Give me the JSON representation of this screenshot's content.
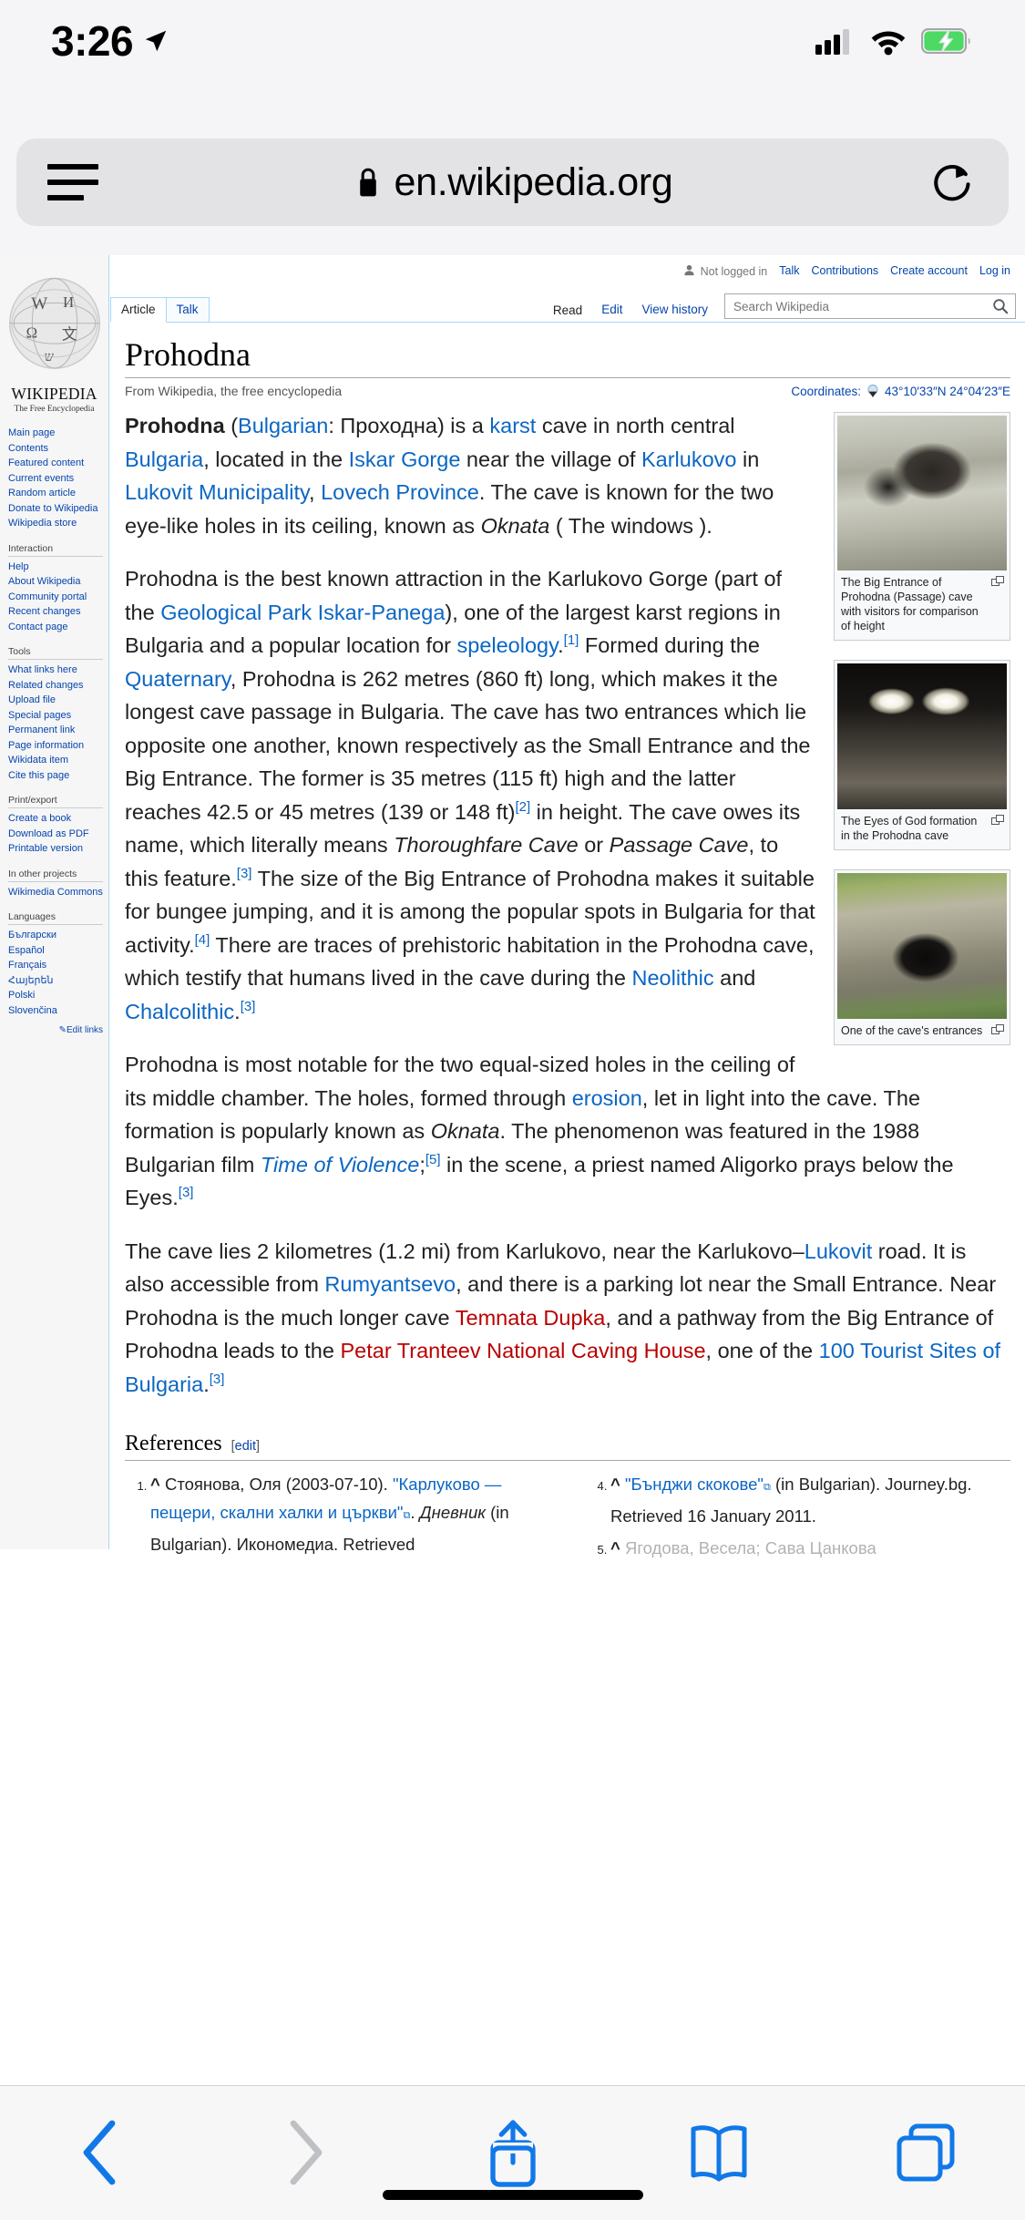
{
  "status_bar": {
    "time": "3:26",
    "location_icon": "location-arrow-icon",
    "cellular_icon": "cellular-signal-icon",
    "wifi_icon": "wifi-icon",
    "battery_icon": "battery-charging-icon"
  },
  "browser": {
    "menu_icon": "hamburger-menu-icon",
    "lock_icon": "lock-icon",
    "url": "en.wikipedia.org",
    "reload_icon": "reload-icon",
    "toolbar": {
      "back_icon": "chevron-left-icon",
      "forward_icon": "chevron-right-icon",
      "share_icon": "share-icon",
      "bookmarks_icon": "book-icon",
      "tabs_icon": "tabs-icon"
    }
  },
  "wiki": {
    "wordmark_main": "WIKIPEDIA",
    "wordmark_sub": "The Free Encyclopedia",
    "personal": {
      "not_logged_in": "Not logged in",
      "links": [
        "Talk",
        "Contributions",
        "Create account",
        "Log in"
      ]
    },
    "namespace_tabs": [
      {
        "label": "Article",
        "selected": true
      },
      {
        "label": "Talk",
        "selected": false
      }
    ],
    "view_tabs": [
      {
        "label": "Read",
        "selected": true
      },
      {
        "label": "Edit",
        "selected": false
      },
      {
        "label": "View history",
        "selected": false
      }
    ],
    "search_placeholder": "Search Wikipedia",
    "search_value": "",
    "sidebar": [
      {
        "heading": "",
        "items": [
          "Main page",
          "Contents",
          "Featured content",
          "Current events",
          "Random article",
          "Donate to Wikipedia",
          "Wikipedia store"
        ]
      },
      {
        "heading": "Interaction",
        "items": [
          "Help",
          "About Wikipedia",
          "Community portal",
          "Recent changes",
          "Contact page"
        ]
      },
      {
        "heading": "Tools",
        "items": [
          "What links here",
          "Related changes",
          "Upload file",
          "Special pages",
          "Permanent link",
          "Page information",
          "Wikidata item",
          "Cite this page"
        ]
      },
      {
        "heading": "Print/export",
        "items": [
          "Create a book",
          "Download as PDF",
          "Printable version"
        ]
      },
      {
        "heading": "In other projects",
        "items": [
          "Wikimedia Commons"
        ]
      },
      {
        "heading": "Languages",
        "items": [
          "Български",
          "Español",
          "Français",
          "Հայերեն",
          "Polski",
          "Slovenčina"
        ]
      }
    ],
    "edit_links": "Edit links"
  },
  "article": {
    "title": "Prohodna",
    "site_sub": "From Wikipedia, the free encyclopedia",
    "coordinates_label": "Coordinates:",
    "coordinates_value": "43°10′33″N 24°04′23″E",
    "thumbs": [
      {
        "caption": "The Big Entrance of Prohodna (Passage) cave with visitors for comparison of height",
        "magnify_icon": "magnify-icon"
      },
      {
        "caption": "The Eyes of God formation in the Prohodna cave",
        "magnify_icon": "magnify-icon"
      },
      {
        "caption": "One of the cave's entrances",
        "magnify_icon": "magnify-icon"
      }
    ],
    "paragraphs": [
      [
        {
          "t": "Prohodna",
          "s": "b"
        },
        {
          "t": " ("
        },
        {
          "t": "Bulgarian",
          "s": "a"
        },
        {
          "t": ": Проходна) is a "
        },
        {
          "t": "karst",
          "s": "a"
        },
        {
          "t": " cave in north central "
        },
        {
          "t": "Bulgaria",
          "s": "a"
        },
        {
          "t": ", located in the "
        },
        {
          "t": "Iskar Gorge",
          "s": "a"
        },
        {
          "t": " near the village of "
        },
        {
          "t": "Karlukovo",
          "s": "a"
        },
        {
          "t": " in "
        },
        {
          "t": "Lukovit Municipality",
          "s": "a"
        },
        {
          "t": ", "
        },
        {
          "t": "Lovech Province",
          "s": "a"
        },
        {
          "t": ". The cave is known for the two eye-like holes in its ceiling, known as "
        },
        {
          "t": "Oknata",
          "s": "i"
        },
        {
          "t": " ( The windows )."
        }
      ],
      [
        {
          "t": "Prohodna is the best known attraction in the Karlukovo Gorge (part of the "
        },
        {
          "t": "Geological Park Iskar-Panega",
          "s": "a"
        },
        {
          "t": "), one of the largest karst regions in Bulgaria and a popular location for "
        },
        {
          "t": "speleology",
          "s": "a"
        },
        {
          "t": "."
        },
        {
          "t": "[1]",
          "s": "sup"
        },
        {
          "t": " Formed during the "
        },
        {
          "t": "Quaternary",
          "s": "a"
        },
        {
          "t": ", Prohodna is 262 metres (860 ft) long, which makes it the longest cave passage in Bulgaria. The cave has two entrances which lie opposite one another, known respectively as the Small Entrance and the Big Entrance. The former is 35 metres (115 ft) high and the latter reaches 42.5 or 45 metres (139 or 148 ft)"
        },
        {
          "t": "[2]",
          "s": "sup"
        },
        {
          "t": " in height. The cave owes its name, which literally means "
        },
        {
          "t": "Thoroughfare Cave",
          "s": "i"
        },
        {
          "t": " or "
        },
        {
          "t": "Passage Cave",
          "s": "i"
        },
        {
          "t": ", to this feature."
        },
        {
          "t": "[3]",
          "s": "sup"
        },
        {
          "t": " The size of the Big Entrance of Prohodna makes it suitable for bungee jumping, and it is among the popular spots in Bulgaria for that activity."
        },
        {
          "t": "[4]",
          "s": "sup"
        },
        {
          "t": " There are traces of prehistoric habitation in the Prohodna cave, which testify that humans lived in the cave during the "
        },
        {
          "t": "Neolithic",
          "s": "a"
        },
        {
          "t": " and "
        },
        {
          "t": "Chalcolithic",
          "s": "a"
        },
        {
          "t": "."
        },
        {
          "t": "[3]",
          "s": "sup"
        }
      ],
      [
        {
          "t": "Prohodna is most notable for the two equal-sized holes in the ceiling of its middle chamber. The holes, formed through "
        },
        {
          "t": "erosion",
          "s": "a"
        },
        {
          "t": ", let in light into the cave. The formation is popularly known as "
        },
        {
          "t": "Oknata",
          "s": "i"
        },
        {
          "t": ". The phenomenon was featured in the 1988 Bulgarian film "
        },
        {
          "t": "Time of Violence",
          "s": "ai"
        },
        {
          "t": ";"
        },
        {
          "t": "[5]",
          "s": "sup"
        },
        {
          "t": " in the scene, a priest named Aligorko prays below the Eyes."
        },
        {
          "t": "[3]",
          "s": "sup"
        }
      ],
      [
        {
          "t": "The cave lies 2 kilometres (1.2 mi) from Karlukovo, near the Karlukovo–"
        },
        {
          "t": "Lukovit",
          "s": "a"
        },
        {
          "t": " road. It is also accessible from "
        },
        {
          "t": "Rumyantsevo",
          "s": "a"
        },
        {
          "t": ", and there is a parking lot near the Small Entrance. Near Prohodna is the much longer cave "
        },
        {
          "t": "Temnata Dupka",
          "s": "r"
        },
        {
          "t": ", and a pathway from the Big Entrance of Prohodna leads to the "
        },
        {
          "t": "Petar Tranteev National Caving House",
          "s": "r"
        },
        {
          "t": ", one of the "
        },
        {
          "t": "100 Tourist Sites of Bulgaria",
          "s": "a"
        },
        {
          "t": "."
        },
        {
          "t": "[3]",
          "s": "sup"
        }
      ]
    ],
    "references": {
      "heading": "References",
      "edit_label": "edit",
      "left_items": [
        [
          {
            "t": "^ ",
            "s": "caret"
          },
          {
            "t": "Стоянова, Оля (2003-07-10). "
          },
          {
            "t": "\"Карлуково — пещери, скални халки и църкви\"",
            "s": "a"
          },
          {
            "t": "⧉",
            "s": "ext"
          },
          {
            "t": ". "
          },
          {
            "t": "Дневник",
            "s": "i"
          },
          {
            "t": " (in Bulgarian). Икономедиа. Retrieved"
          }
        ]
      ],
      "right_items": [
        [
          {
            "t": "^ ",
            "s": "caret"
          },
          {
            "t": "\"Бънджи скокове\"",
            "s": "a"
          },
          {
            "t": "⧉",
            "s": "ext"
          },
          {
            "t": " (in Bulgarian). Journey.bg. Retrieved 16 January 2011."
          }
        ],
        [
          {
            "t": "^ ",
            "s": "caret"
          },
          {
            "t": "Ягодова, Весела; Сава Цанкова",
            "s": "faded"
          }
        ]
      ],
      "right_start": 4
    }
  },
  "colors": {
    "link": "#0b66c3",
    "sidebar_link": "#0645ad",
    "redlink": "#ba0000",
    "wiki_border": "#a7d7f9",
    "chrome_bg": "#f7f7f8",
    "urlbar_bg": "#e3e3e5",
    "battery_green": "#4cd964"
  }
}
